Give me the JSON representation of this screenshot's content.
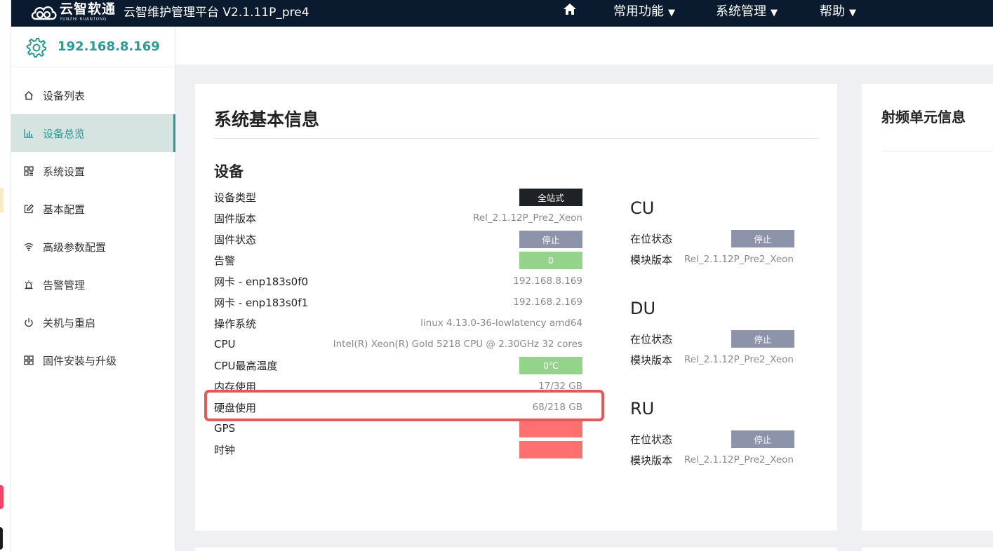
{
  "brand": {
    "name_cn": "云智软通",
    "name_en": "YUNZHI RUANTONG"
  },
  "app_title": "云智维护管理平台 V2.1.11P_pre4",
  "topnav": {
    "items": [
      {
        "label": "常用功能",
        "caret": "▼"
      },
      {
        "label": "系统管理",
        "caret": "▼"
      },
      {
        "label": "帮助",
        "caret": "▼"
      }
    ]
  },
  "sidebar": {
    "device_ip": "192.168.8.169",
    "items": [
      {
        "label": "设备列表",
        "icon": "home-icon"
      },
      {
        "label": "设备总览",
        "icon": "bar-chart-icon",
        "active": true
      },
      {
        "label": "系统设置",
        "icon": "grid-icon"
      },
      {
        "label": "基本配置",
        "icon": "edit-icon"
      },
      {
        "label": "高级参数配置",
        "icon": "wifi-icon"
      },
      {
        "label": "告警管理",
        "icon": "alarm-icon"
      },
      {
        "label": "关机与重启",
        "icon": "power-icon"
      },
      {
        "label": "固件安装与升级",
        "icon": "apps-icon"
      }
    ]
  },
  "main": {
    "title": "系统基本信息",
    "device_section": {
      "title": "设备",
      "rows": [
        {
          "label": "设备类型",
          "value": "全站式",
          "kind": "badge",
          "color": "#1f2225"
        },
        {
          "label": "固件版本",
          "value": "Rel_2.1.12P_Pre2_Xeon",
          "kind": "text"
        },
        {
          "label": "固件状态",
          "value": "停止",
          "kind": "badge",
          "color": "#8d93a9"
        },
        {
          "label": "告警",
          "value": "0",
          "kind": "badge",
          "color": "#94d48a"
        },
        {
          "label": "网卡 - enp183s0f0",
          "value": "192.168.8.169",
          "kind": "text"
        },
        {
          "label": "网卡 - enp183s0f1",
          "value": "192.168.2.169",
          "kind": "text"
        },
        {
          "label": "操作系统",
          "value": "linux 4.13.0-36-lowlatency amd64",
          "kind": "text"
        },
        {
          "label": "CPU",
          "value": "Intel(R) Xeon(R) Gold 5218 CPU @ 2.30GHz 32 cores",
          "kind": "text"
        },
        {
          "label": "CPU最高温度",
          "value": "0℃",
          "kind": "badge",
          "color": "#94d48a"
        },
        {
          "label": "内存使用",
          "value": "17/32 GB",
          "kind": "text"
        },
        {
          "label": "硬盘使用",
          "value": "68/218 GB",
          "kind": "text",
          "highlighted": true
        },
        {
          "label": "GPS",
          "value": "",
          "kind": "badge",
          "color": "#ff7070"
        },
        {
          "label": "时钟",
          "value": "",
          "kind": "badge",
          "color": "#ff7070"
        }
      ]
    },
    "units": [
      {
        "title": "CU",
        "status_label": "在位状态",
        "status": "停止",
        "version_label": "模块版本",
        "version": "Rel_2.1.12P_Pre2_Xeon"
      },
      {
        "title": "DU",
        "status_label": "在位状态",
        "status": "停止",
        "version_label": "模块版本",
        "version": "Rel_2.1.12P_Pre2_Xeon"
      },
      {
        "title": "RU",
        "status_label": "在位状态",
        "status": "停止",
        "version_label": "模块版本",
        "version": "Rel_2.1.12P_Pre2_Xeon"
      }
    ]
  },
  "rf_panel": {
    "title": "射频单元信息"
  },
  "colors": {
    "accent": "#2a9a96",
    "topbar": "#0a1a2f",
    "highlight_border": "#e35858"
  }
}
